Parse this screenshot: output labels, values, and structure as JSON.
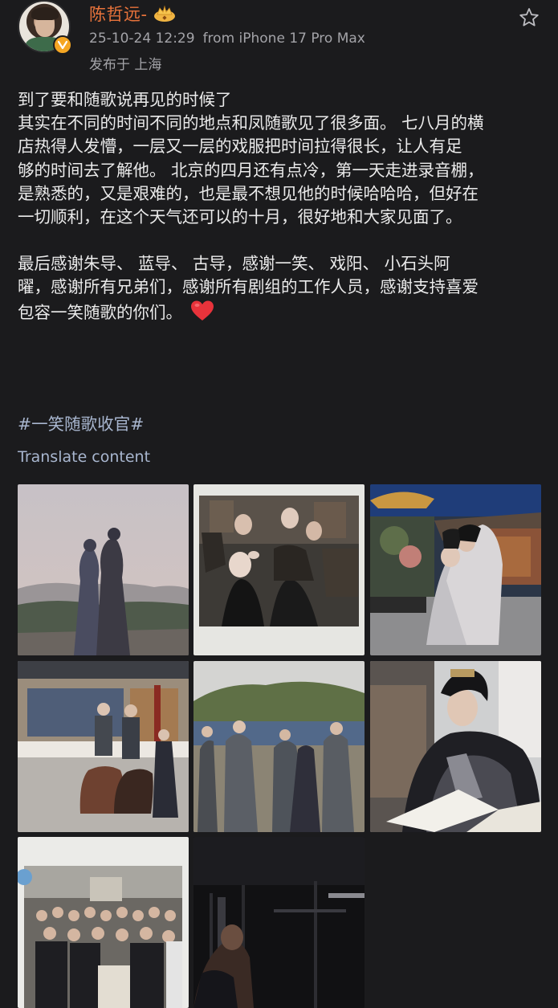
{
  "author": {
    "name": "陈哲远-",
    "verified_icon": "verified-badge-icon",
    "level_icon": "crown-badge-icon"
  },
  "meta": {
    "timestamp": "25-10-24 12:29",
    "device": "from iPhone 17 Pro Max",
    "location": "发布于 上海"
  },
  "post": {
    "lines": [
      "到了要和随歌说再见的时候了",
      "其实在不同的时间不同的地点和凤随歌见了很多面。 七八月的横",
      "店热得人发懵，一层又一层的戏服把时间拉得很长，让人有足",
      "够的时间去了解他。 北京的四月还有点冷，第一天走进录音棚，",
      "是熟悉的，又是艰难的，也是最不想见他的时候哈哈哈，但好在",
      "一切顺利，在这个天气还可以的十月，很好地和大家见面了。",
      "最后感谢朱导、 蓝导、 古导，感谢一笑、 戏阳、 小石头阿",
      "曜，感谢所有兄弟们，感谢所有剧组的工作人员，感谢支持喜爱",
      "包容一笑随歌的你们。"
    ],
    "emoji": "heart-emoji",
    "hashtag": "#一笑随歌收官#",
    "translate_label": "Translate content"
  },
  "photos": [
    {
      "name": "photo-1",
      "subject": "two costumed figures silhouetted against hazy mountains"
    },
    {
      "name": "photo-2",
      "subject": "polaroid group selfie of cast in black outfits"
    },
    {
      "name": "photo-3",
      "subject": "actor carrying costar on courtyard set"
    },
    {
      "name": "photo-4",
      "subject": "armored riders on horses before palace wall"
    },
    {
      "name": "photo-5",
      "subject": "armored soldiers standing in valley"
    },
    {
      "name": "photo-6",
      "subject": "ornate costumed actor reading script"
    },
    {
      "name": "photo-7",
      "subject": "polaroid large crew group photo"
    },
    {
      "name": "photo-8",
      "subject": "dim gym interior with person"
    }
  ],
  "colors": {
    "background": "#1b1b1d",
    "username": "#e8733b",
    "meta": "#a3a3a8",
    "link": "#a8b6cf",
    "text": "#ebebeb"
  }
}
